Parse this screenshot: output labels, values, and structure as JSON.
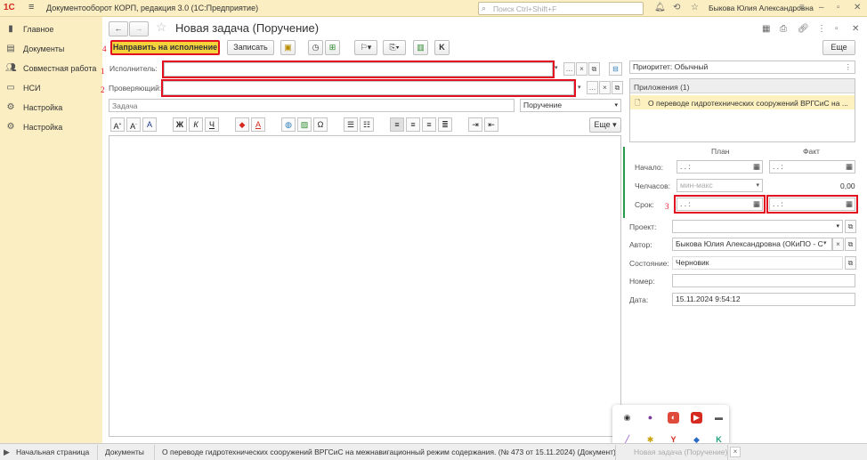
{
  "titlebar": {
    "logo": "1С",
    "menu_icon": "≡",
    "title": "Документооборот КОРП, редакция 3.0  (1С:Предприятие)",
    "search_placeholder": "Поиск Ctrl+Shift+F",
    "user": "Быкова Юлия Александровна"
  },
  "sidebar": {
    "items": [
      {
        "label": "Главное",
        "icon": "home-icon"
      },
      {
        "label": "Документы",
        "icon": "documents-icon"
      },
      {
        "label": "Совместная работа",
        "icon": "people-icon"
      },
      {
        "label": "НСИ",
        "icon": "folder-icon"
      },
      {
        "label": "Настройка",
        "icon": "gear-icon"
      },
      {
        "label": "Настройка",
        "icon": "gear-icon"
      }
    ]
  },
  "form": {
    "title": "Новая задача (Поручение)",
    "toolbar": {
      "send_label": "Направить на исполнение",
      "save_label": "Записать",
      "more_label": "Еще"
    },
    "executor_label": "Исполнитель:",
    "checker_label": "Проверяющий:",
    "task_placeholder": "Задача",
    "task_type": "Поручение",
    "editor_more_label": "Еще",
    "annotations": [
      "1",
      "2",
      "3",
      "4"
    ],
    "format_buttons": {
      "bold": "Ж",
      "italic": "К",
      "underline": "Ч",
      "omega": "Ω"
    }
  },
  "right_panel": {
    "priority": "Приоритет: Обычный",
    "attachments_header": "Приложения (1)",
    "attachment": "О переводе гидротехнических сооружений  ВРГСиС на ...",
    "plan_label": "План",
    "fact_label": "Факт",
    "start_label": "Начало:",
    "hours_label": "Челчасов:",
    "hours_placeholder": "мин-макс",
    "hours_fact": "0,00",
    "deadline_label": "Срок:",
    "date_mask": " .  .       :  ",
    "project_label": "Проект:",
    "author_label": "Автор:",
    "author_value": "Быкова Юлия Александровна (ОКиПО - С",
    "state_label": "Состояние:",
    "state_value": "Черновик",
    "number_label": "Номер:",
    "date_label": "Дата:",
    "date_value": "15.11.2024  9:54:12"
  },
  "tabs": [
    "Начальная страница",
    "Документы",
    "О переводе гидротехнических сооружений  ВРГСиС на межнавигационный режим содержания. (№ 473 от 15.11.2024) (Документ)",
    "Новая задача (Поручение)"
  ],
  "colors": {
    "accent": "#f5d33d",
    "sidebar_bg": "#fbeec2",
    "highlight": "#e3101f"
  }
}
